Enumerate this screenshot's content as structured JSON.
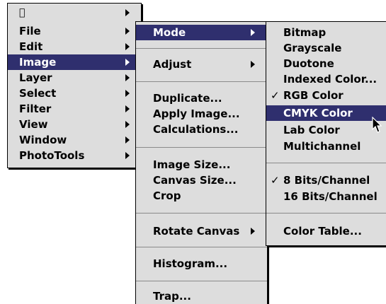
{
  "menu_bar": {
    "apple_glyph": "",
    "items": [
      {
        "label": "File"
      },
      {
        "label": "Edit"
      },
      {
        "label": "Image"
      },
      {
        "label": "Layer"
      },
      {
        "label": "Select"
      },
      {
        "label": "Filter"
      },
      {
        "label": "View"
      },
      {
        "label": "Window"
      },
      {
        "label": "PhotoTools"
      }
    ],
    "highlighted": "Image"
  },
  "image_menu": {
    "mode": "Mode",
    "adjust": "Adjust",
    "duplicate": "Duplicate...",
    "apply_image": "Apply Image...",
    "calculations": "Calculations...",
    "image_size": "Image Size...",
    "canvas_size": "Canvas Size...",
    "crop": "Crop",
    "rotate_canvas": "Rotate Canvas",
    "histogram": "Histogram...",
    "trap": "Trap...",
    "highlighted": "Mode"
  },
  "mode_menu": {
    "bitmap": "Bitmap",
    "grayscale": "Grayscale",
    "duotone": "Duotone",
    "indexed_color": "Indexed Color...",
    "rgb_color": "RGB Color",
    "cmyk_color": "CMYK Color",
    "lab_color": "Lab Color",
    "multichannel": "Multichannel",
    "bits8": "8 Bits/Channel",
    "bits16": "16 Bits/Channel",
    "color_table": "Color Table...",
    "checkmark": "✓",
    "highlighted": "CMYK Color",
    "checked": [
      "RGB Color",
      "8 Bits/Channel"
    ]
  },
  "colors": {
    "menu_bg": "#dddddd",
    "highlight": "#2f2f6e",
    "highlight_text": "#ffffff",
    "separator": "#8a8a8a"
  }
}
